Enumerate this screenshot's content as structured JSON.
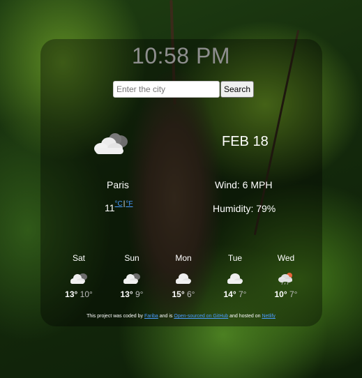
{
  "header": {
    "time": "10:58 PM"
  },
  "search": {
    "placeholder": "Enter the city",
    "button_label": "Search"
  },
  "current": {
    "icon": "cloud-icon",
    "date": "FEB 18",
    "city": "Paris",
    "temperature": "11",
    "unit_c": "°C",
    "unit_sep": "|",
    "unit_f": "°F",
    "wind": "Wind: 6 MPH",
    "humidity": "Humidity: 79%"
  },
  "forecast": [
    {
      "day": "Sat",
      "icon": "cloud-icon",
      "high": "13°",
      "low": "10°"
    },
    {
      "day": "Sun",
      "icon": "cloud-icon",
      "high": "13°",
      "low": "9°"
    },
    {
      "day": "Mon",
      "icon": "cloud-icon",
      "high": "15°",
      "low": "6°"
    },
    {
      "day": "Tue",
      "icon": "cloud-icon",
      "high": "14°",
      "low": "7°"
    },
    {
      "day": "Wed",
      "icon": "rain-cloud-icon",
      "high": "10°",
      "low": "7°"
    }
  ],
  "footer": {
    "text1": "This project was coded by ",
    "link1": "Fariba",
    "text2": " and is ",
    "link2": "Open-sourced on GitHub",
    "text3": " and hosted on ",
    "link3": "Netlify"
  }
}
